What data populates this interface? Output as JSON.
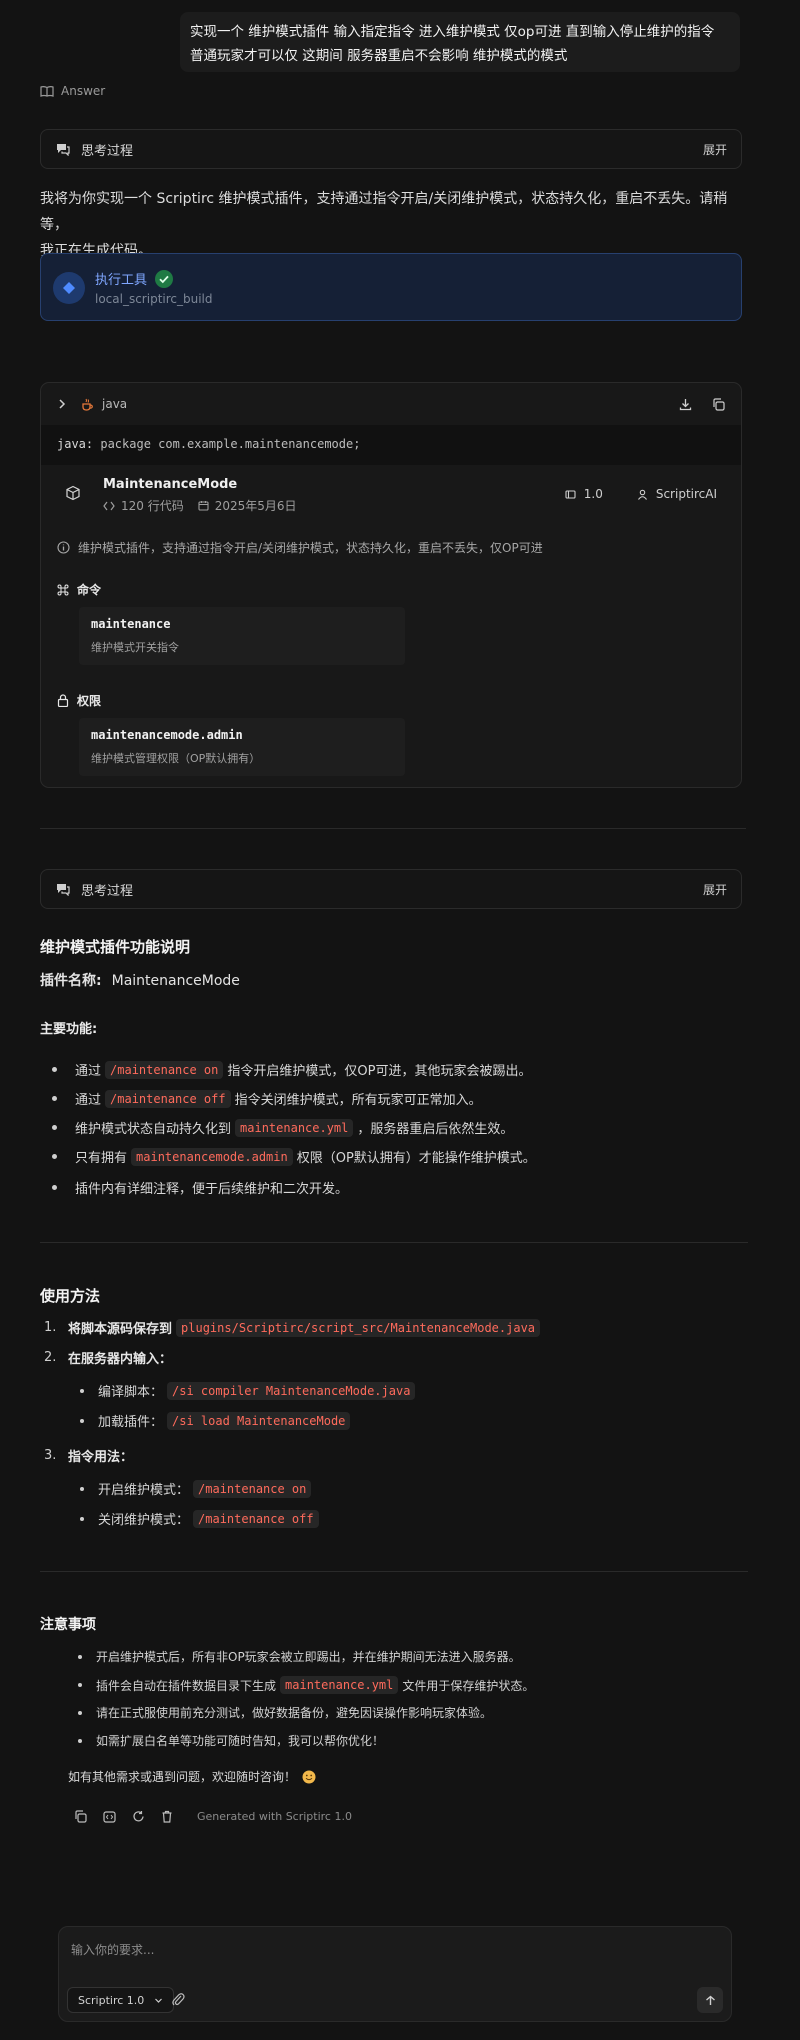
{
  "user_message": {
    "line1": "实现一个 维护模式插件 输入指定指令 进入维护模式 仅op可进 直到输入停止维护的指令",
    "line2": "普通玩家才可以仅 这期间 服务器重启不会影响 维护模式的模式"
  },
  "answer_label": "Answer",
  "thinking": {
    "label": "思考过程",
    "expand": "展开"
  },
  "intro_line1": "我将为你实现一个 Scriptirc 维护模式插件，支持通过指令开启/关闭维护模式，状态持久化，重启不丢失。请稍等，",
  "intro_line2": "我正在生成代码。",
  "tool": {
    "title": "执行工具",
    "subtitle": "local_scriptirc_build"
  },
  "code_card": {
    "lang": "java",
    "code_prefix": "java:",
    "code_text": " package com.example.maintenancemode;",
    "plugin_name": "MaintenanceMode",
    "lines": "120 行代码",
    "date": "2025年5月6日",
    "version": "1.0",
    "author": "ScriptircAI",
    "description": "维护模式插件，支持通过指令开启/关闭维护模式，状态持久化，重启不丢失，仅OP可进",
    "commands_title": "命令",
    "command_name": "maintenance",
    "command_desc": "维护模式开关指令",
    "perms_title": "权限",
    "perm_name": "maintenancemode.admin",
    "perm_desc": "维护模式管理权限（OP默认拥有）"
  },
  "doc": {
    "title": "维护模式插件功能说明",
    "name_label": "插件名称:",
    "name_value": "MaintenanceMode",
    "features_title": "主要功能:",
    "f1_pre": "通过",
    "f1_code": "/maintenance on",
    "f1_post": "指令开启维护模式，仅OP可进，其他玩家会被踢出。",
    "f2_pre": "通过",
    "f2_code": "/maintenance off",
    "f2_post": "指令关闭维护模式，所有玩家可正常加入。",
    "f3_pre": "维护模式状态自动持久化到",
    "f3_code": "maintenance.yml",
    "f3_post": "，服务器重启后依然生效。",
    "f4_pre": "只有拥有",
    "f4_code": "maintenancemode.admin",
    "f4_post": "权限（OP默认拥有）才能操作维护模式。",
    "f5": "插件内有详细注释，便于后续维护和二次开发。",
    "usage_title": "使用方法",
    "u1_num": "1.",
    "u1_text": "将脚本源码保存到",
    "u1_code": "plugins/Scriptirc/script_src/MaintenanceMode.java",
    "u2_num": "2.",
    "u2_text": "在服务器内输入：",
    "u2a_pre": "编译脚本：",
    "u2a_code": "/si compiler MaintenanceMode.java",
    "u2b_pre": "加载插件：",
    "u2b_code": "/si load MaintenanceMode",
    "u3_num": "3.",
    "u3_text": "指令用法：",
    "u3a_pre": "开启维护模式：",
    "u3a_code": "/maintenance on",
    "u3b_pre": "关闭维护模式：",
    "u3b_code": "/maintenance off",
    "notes_title": "注意事项",
    "n1": "开启维护模式后，所有非OP玩家会被立即踢出，并在维护期间无法进入服务器。",
    "n2_pre": "插件会自动在插件数据目录下生成",
    "n2_code": "maintenance.yml",
    "n2_post": "文件用于保存维护状态。",
    "n3": "请在正式服使用前充分测试，做好数据备份，避免因误操作影响玩家体验。",
    "n4": "如需扩展白名单等功能可随时告知，我可以帮你优化！",
    "closing": "如有其他需求或遇到问题，欢迎随时咨询！",
    "generated": "Generated with Scriptirc 1.0"
  },
  "composer": {
    "placeholder": "输入你的要求...",
    "model": "Scriptirc 1.0"
  }
}
